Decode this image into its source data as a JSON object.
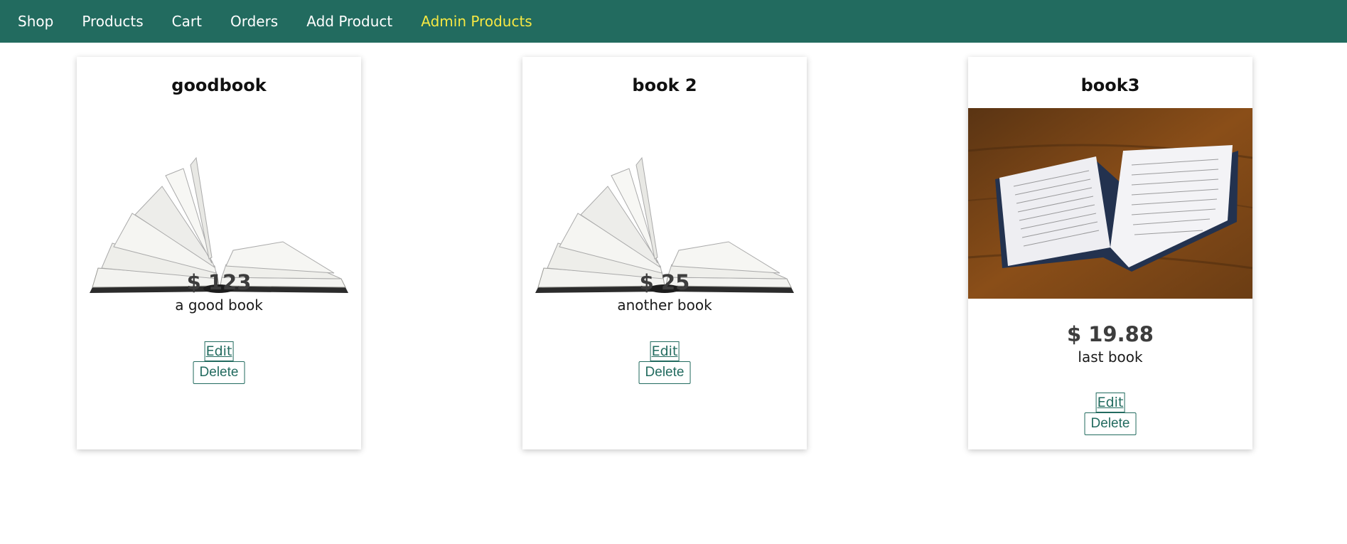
{
  "nav": {
    "items": [
      {
        "label": "Shop"
      },
      {
        "label": "Products"
      },
      {
        "label": "Cart"
      },
      {
        "label": "Orders"
      },
      {
        "label": "Add Product"
      },
      {
        "label": "Admin Products",
        "active": true
      }
    ]
  },
  "products": [
    {
      "title": "goodbook",
      "price": "$ 123",
      "description": "a good book",
      "image": "open-book-icon",
      "edit_label": "Edit",
      "delete_label": "Delete"
    },
    {
      "title": "book 2",
      "price": "$ 25",
      "description": "another book",
      "image": "open-book-icon",
      "edit_label": "Edit",
      "delete_label": "Delete"
    },
    {
      "title": "book3",
      "price": "$ 19.88",
      "description": "last book",
      "image": "dictionary-photo",
      "edit_label": "Edit",
      "delete_label": "Delete"
    }
  ],
  "colors": {
    "nav_bg": "#226b5f",
    "active_link": "#f7e842",
    "accent": "#226b5f"
  }
}
